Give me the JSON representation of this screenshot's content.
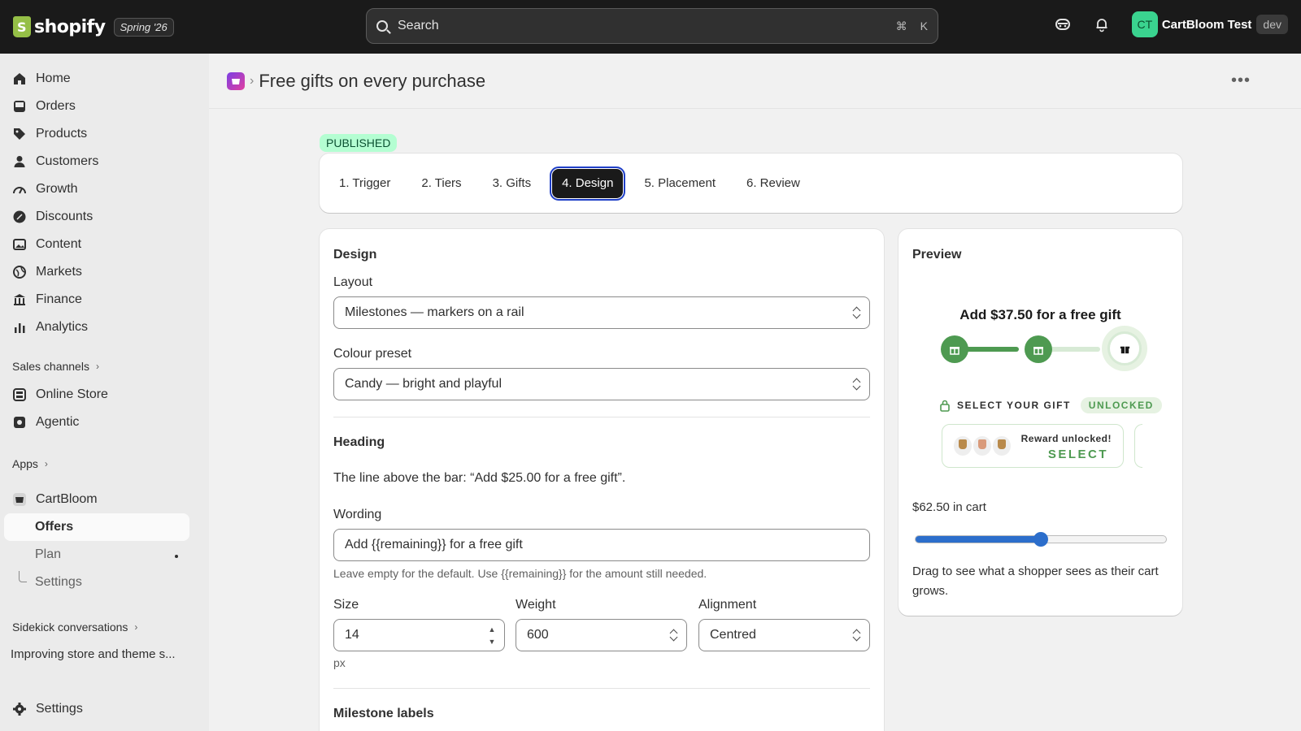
{
  "topbar": {
    "logo_text": "shopify",
    "edition": "Spring '26",
    "search_placeholder": "Search",
    "shortcut_cmd": "⌘",
    "shortcut_key": "K",
    "avatar_initials": "CT",
    "store_name": "CartBloom Test",
    "env_badge": "dev"
  },
  "sidebar": {
    "items": [
      {
        "label": "Home",
        "icon": "home-icon"
      },
      {
        "label": "Orders",
        "icon": "inbox-icon"
      },
      {
        "label": "Products",
        "icon": "tag-icon"
      },
      {
        "label": "Customers",
        "icon": "person-icon"
      },
      {
        "label": "Growth",
        "icon": "gauge-icon"
      },
      {
        "label": "Discounts",
        "icon": "discount-icon"
      },
      {
        "label": "Content",
        "icon": "image-icon"
      },
      {
        "label": "Markets",
        "icon": "globe-icon"
      },
      {
        "label": "Finance",
        "icon": "bank-icon"
      },
      {
        "label": "Analytics",
        "icon": "bar-chart-icon"
      }
    ],
    "sales_channels_label": "Sales channels",
    "channels": [
      {
        "label": "Online Store",
        "icon": "store-icon"
      },
      {
        "label": "Agentic",
        "icon": "agentic-icon"
      }
    ],
    "apps_label": "Apps",
    "app_name": "CartBloom",
    "app_subitems": [
      "Offers",
      "Plan",
      "Settings"
    ],
    "sidekick_label": "Sidekick conversations",
    "sidekick_item": "Improving store and theme s...",
    "settings_label": "Settings"
  },
  "header": {
    "title": "Free gifts on every purchase"
  },
  "status": "PUBLISHED",
  "tabs": [
    "1. Trigger",
    "2. Tiers",
    "3. Gifts",
    "4. Design",
    "5. Placement",
    "6. Review"
  ],
  "active_tab": "4. Design",
  "design": {
    "title": "Design",
    "layout_label": "Layout",
    "layout_value": "Milestones — markers on a rail",
    "colour_label": "Colour preset",
    "colour_value": "Candy — bright and playful",
    "heading_title": "Heading",
    "heading_desc": "The line above the bar: “Add $25.00 for a free gift”.",
    "wording_label": "Wording",
    "wording_value": "Add {{remaining}} for a free gift",
    "wording_help": "Leave empty for the default. Use {{remaining}} for the amount still needed.",
    "size_label": "Size",
    "size_value": "14",
    "size_unit": "px",
    "weight_label": "Weight",
    "weight_value": "600",
    "alignment_label": "Alignment",
    "alignment_value": "Centred",
    "milestone_title": "Milestone labels"
  },
  "preview": {
    "title": "Preview",
    "heading": "Add $37.50 for a free gift",
    "select_label": "SELECT YOUR GIFT",
    "unlocked_badge": "UNLOCKED",
    "reward_text": "Reward unlocked!",
    "reward_action": "SELECT",
    "cart_label": "$62.50 in cart",
    "slider_value": 0.5,
    "help": "Drag to see what a shopper sees as their cart grows.",
    "colors": {
      "green": "#4e9a51",
      "rail_light": "#d7ead5",
      "slider": "#2c6ecb"
    }
  }
}
